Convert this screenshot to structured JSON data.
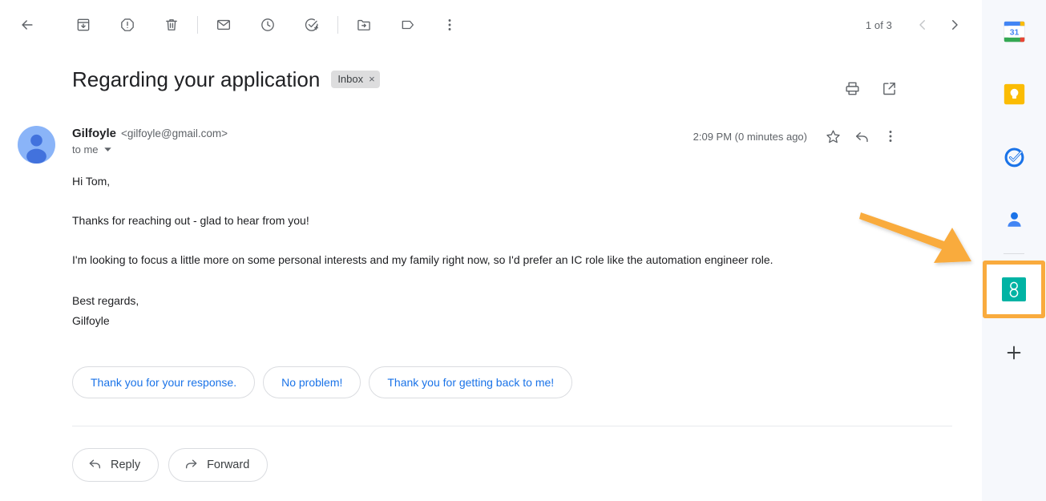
{
  "toolbar": {
    "back_label": "Back",
    "actions": [
      {
        "name": "archive-button",
        "label": "Archive"
      },
      {
        "name": "report-spam-button",
        "label": "Report spam"
      },
      {
        "name": "delete-button",
        "label": "Delete"
      },
      {
        "name": "mark-unread-button",
        "label": "Mark as unread"
      },
      {
        "name": "snooze-button",
        "label": "Snooze"
      },
      {
        "name": "add-to-tasks-button",
        "label": "Add to tasks"
      },
      {
        "name": "move-to-button",
        "label": "Move to"
      },
      {
        "name": "labels-button",
        "label": "Labels"
      },
      {
        "name": "more-options-button",
        "label": "More"
      }
    ],
    "pager": {
      "count_text": "1 of 3",
      "prev_label": "Newer",
      "next_label": "Older"
    }
  },
  "subject": {
    "title": "Regarding your application",
    "label_chip": "Inbox",
    "label_chip_remove": "×",
    "print_label": "Print all",
    "popout_label": "Open in new window"
  },
  "message": {
    "sender_name": "Gilfoyle",
    "sender_email": "<gilfoyle@gmail.com>",
    "recipients": "to me",
    "timestamp": "2:09 PM (0 minutes ago)",
    "star_label": "Star",
    "reply_label": "Reply",
    "more_label": "More",
    "avatar_alt": "Gilfoyle avatar",
    "body": {
      "greeting": "Hi Tom,",
      "paragraph_1": "Thanks for reaching out - glad to hear from you!",
      "paragraph_2": "I'm looking to focus a little more on some personal interests and my family right now, so I'd prefer an IC role like the automation engineer role.",
      "signature": "Best regards,\nGilfoyle"
    }
  },
  "smart_replies": [
    "Thank you for your response.",
    "No problem!",
    "Thank you for getting back to me!"
  ],
  "reply_bar": {
    "reply": "Reply",
    "forward": "Forward"
  },
  "side_panel": {
    "items": [
      {
        "name": "google-calendar-icon",
        "label": "Calendar",
        "day": "31"
      },
      {
        "name": "google-keep-icon",
        "label": "Keep"
      },
      {
        "name": "google-tasks-icon",
        "label": "Tasks"
      },
      {
        "name": "google-contacts-icon",
        "label": "Contacts"
      }
    ],
    "highlighted_addon": {
      "name": "addon-icon",
      "label": "Add-on",
      "color": "#00b3a4"
    },
    "add_addon_label": "Get add-ons"
  },
  "annotation": {
    "arrow_color": "#f9ab3e",
    "highlight_color": "#f9ab3e"
  },
  "colors": {
    "accent_blue": "#1a73e8",
    "text_primary": "#202124",
    "text_secondary": "#5f6368",
    "panel_bg": "#f6f8fc"
  }
}
